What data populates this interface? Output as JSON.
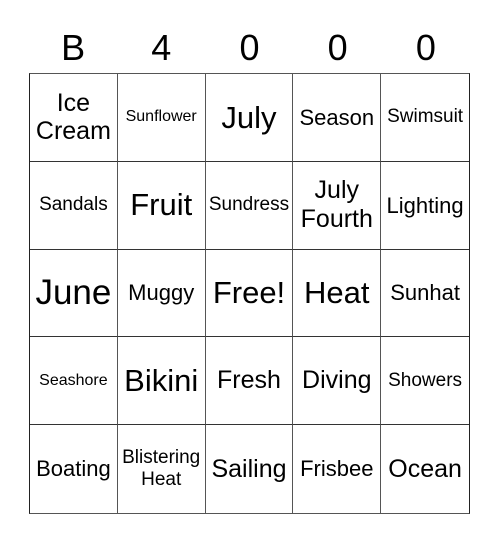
{
  "card": {
    "header": [
      "B",
      "4",
      "0",
      "0",
      "0"
    ],
    "rows": [
      [
        {
          "text": "Ice Cream",
          "size": "lg"
        },
        {
          "text": "Sunflower",
          "size": "xs"
        },
        {
          "text": "July",
          "size": "xl"
        },
        {
          "text": "Season",
          "size": "md"
        },
        {
          "text": "Swimsuit",
          "size": "sm"
        }
      ],
      [
        {
          "text": "Sandals",
          "size": "sm"
        },
        {
          "text": "Fruit",
          "size": "xl"
        },
        {
          "text": "Sundress",
          "size": "sm"
        },
        {
          "text": "July Fourth",
          "size": "lg"
        },
        {
          "text": "Lighting",
          "size": "md"
        }
      ],
      [
        {
          "text": "June",
          "size": "xxl"
        },
        {
          "text": "Muggy",
          "size": "md"
        },
        {
          "text": "Free!",
          "size": "xl"
        },
        {
          "text": "Heat",
          "size": "xl"
        },
        {
          "text": "Sunhat",
          "size": "md"
        }
      ],
      [
        {
          "text": "Seashore",
          "size": "xs"
        },
        {
          "text": "Bikini",
          "size": "xl"
        },
        {
          "text": "Fresh",
          "size": "lg"
        },
        {
          "text": "Diving",
          "size": "lg"
        },
        {
          "text": "Showers",
          "size": "sm"
        }
      ],
      [
        {
          "text": "Boating",
          "size": "md"
        },
        {
          "text": "Blistering Heat",
          "size": "sm"
        },
        {
          "text": "Sailing",
          "size": "lg"
        },
        {
          "text": "Frisbee",
          "size": "md"
        },
        {
          "text": "Ocean",
          "size": "lg"
        }
      ]
    ]
  }
}
